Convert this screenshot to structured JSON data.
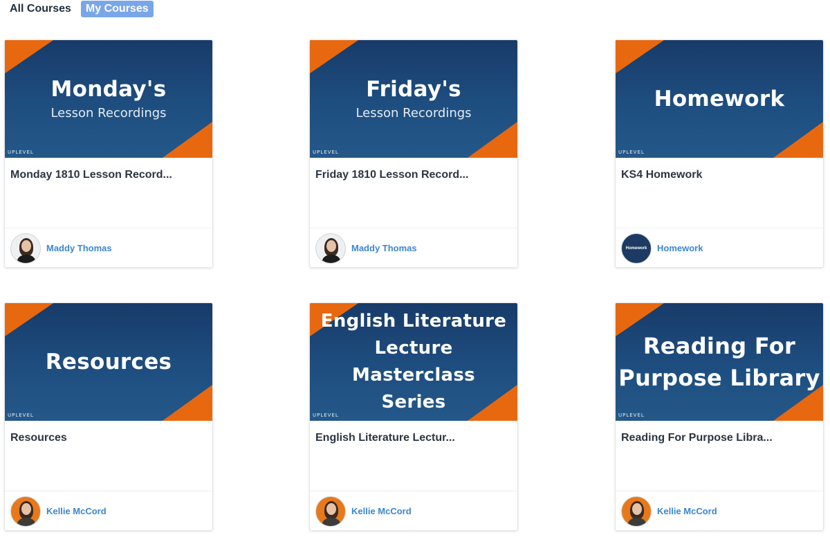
{
  "tabs": [
    {
      "label": "All Courses",
      "active": false
    },
    {
      "label": "My Courses",
      "active": true
    }
  ],
  "brand_logo_text": "UPLEVEL",
  "colors": {
    "accent": "#e8680f",
    "thumb_bg": "#1e4e80",
    "active_tab": "#79a6e8",
    "author_link": "#3b86cf"
  },
  "courses": [
    {
      "thumb_title": "Monday's",
      "thumb_sub": "Lesson Recordings",
      "title": "Monday 1810 Lesson Record...",
      "author": "Maddy Thomas",
      "avatar": "woman-dark-hair-avatar"
    },
    {
      "thumb_title": "Friday's",
      "thumb_sub": "Lesson Recordings",
      "title": "Friday 1810 Lesson Record...",
      "author": "Maddy Thomas",
      "avatar": "woman-dark-hair-avatar"
    },
    {
      "thumb_title": "Homework",
      "thumb_sub": "",
      "title": "KS4 Homework",
      "author": "Homework",
      "avatar": "homework-logo-avatar"
    },
    {
      "thumb_title": "Resources",
      "thumb_sub": "",
      "title": "Resources",
      "author": "Kellie McCord",
      "avatar": "woman-orange-bg-avatar"
    },
    {
      "thumb_title_lines": [
        "English Literature",
        "Lecture Masterclass",
        "Series"
      ],
      "title": "English Literature Lectur...",
      "author": "Kellie McCord",
      "avatar": "woman-orange-bg-avatar"
    },
    {
      "thumb_title_lines": [
        "Reading For",
        "Purpose Library"
      ],
      "title": "Reading For Purpose Libra...",
      "author": "Kellie McCord",
      "avatar": "woman-orange-bg-avatar"
    }
  ],
  "homework_avatar_text": "Homework"
}
